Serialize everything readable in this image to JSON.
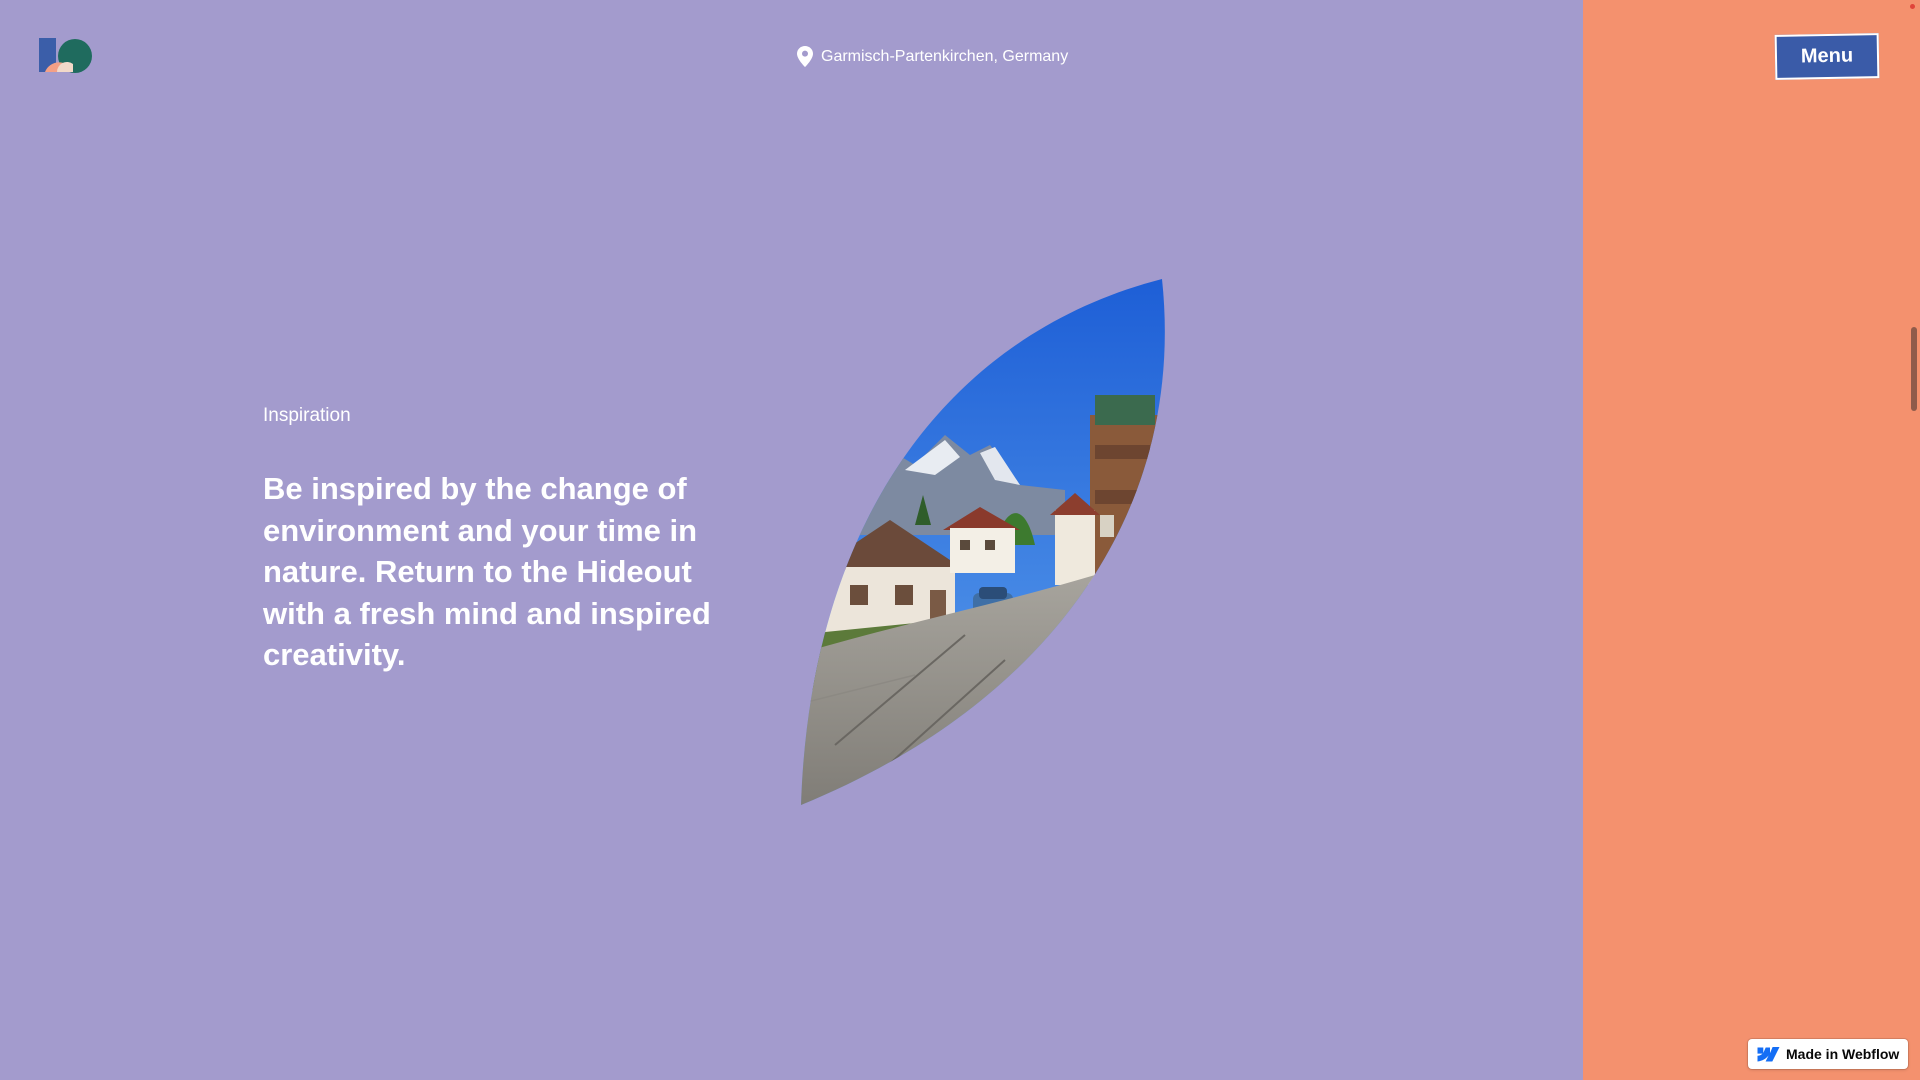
{
  "header": {
    "location_text": "Garmisch-Partenkirchen, Germany",
    "location_icon": "map-pin-icon",
    "menu_label": "Menu",
    "logo_icon": "brand-logo-icon"
  },
  "section": {
    "eyebrow": "Inspiration",
    "headline": "Be inspired by the change of environment and your time in nature. Return to the Hideout with a fresh mind and inspired creativity.",
    "image_description": "village-street-mountain-photo"
  },
  "badge": {
    "label": "Made in Webflow",
    "icon": "webflow-icon"
  },
  "colors": {
    "background": "#a39bcd",
    "panel": "#f4916e",
    "menu_button": "#3a5ba8",
    "text": "#ffffff"
  }
}
